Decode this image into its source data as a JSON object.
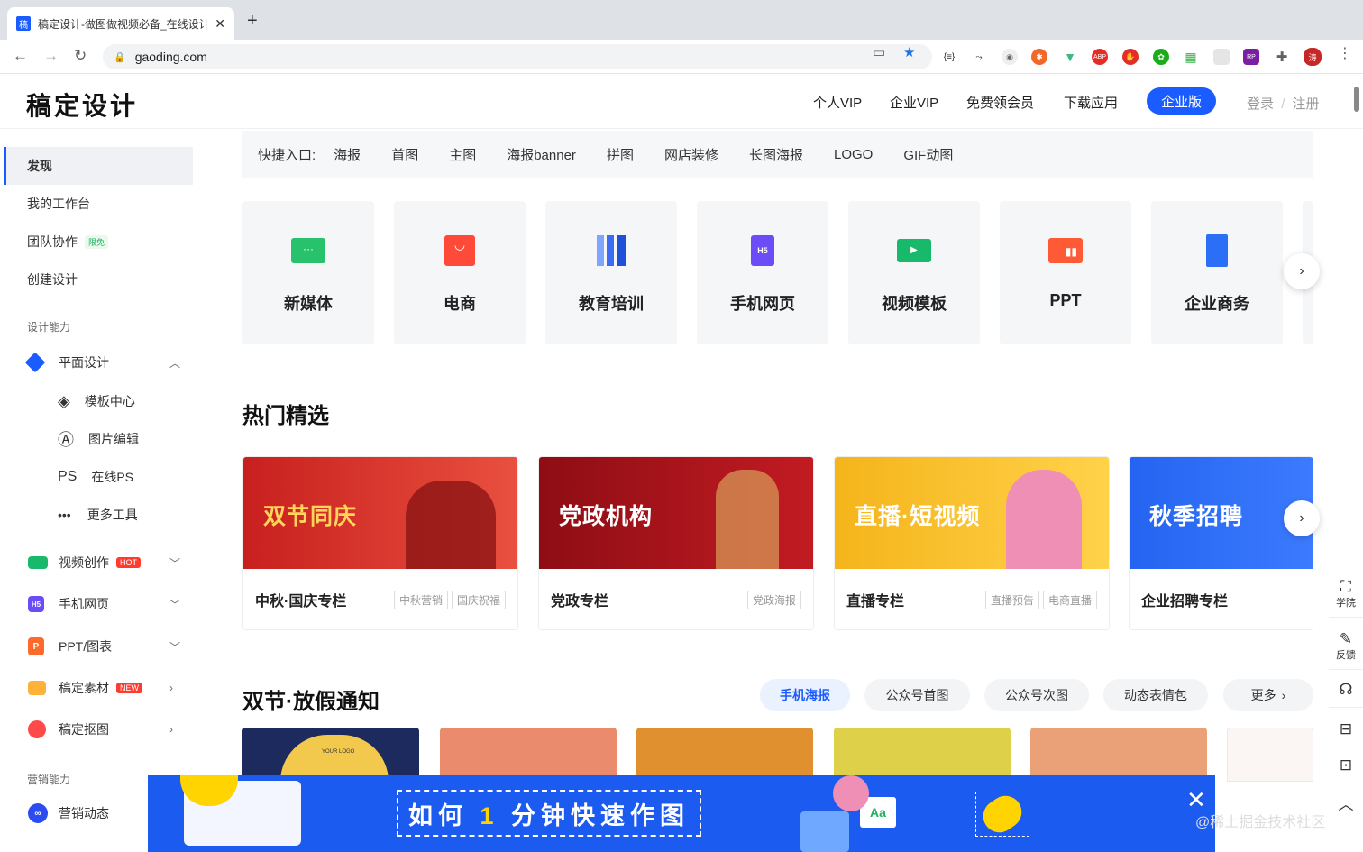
{
  "browser": {
    "tab_title": "稿定设计-做图做视频必备_在线设计",
    "tab_favicon": "稿",
    "url": "gaoding.com",
    "profile_initial": "涛"
  },
  "header": {
    "logo": "稿定设计",
    "nav": [
      "个人VIP",
      "企业VIP",
      "免费领会员",
      "下载应用"
    ],
    "enterprise_button": "企业版",
    "login": "登录",
    "divider": "/",
    "register": "注册"
  },
  "sidebar": {
    "items": [
      {
        "label": "发现"
      },
      {
        "label": "我的工作台"
      },
      {
        "label": "团队协作",
        "badge": "限免"
      },
      {
        "label": "创建设计"
      }
    ],
    "section_design": "设计能力",
    "design": [
      {
        "label": "平面设计",
        "chevron": "up"
      },
      {
        "label": "模板中心"
      },
      {
        "label": "图片编辑"
      },
      {
        "label": "在线PS",
        "icon_text": "PS"
      },
      {
        "label": "更多工具",
        "icon_text": "•••"
      },
      {
        "label": "视频创作",
        "badge": "HOT",
        "chevron": "down"
      },
      {
        "label": "手机网页",
        "icon_text": "H5",
        "chevron": "down"
      },
      {
        "label": "PPT/图表",
        "icon_text": "P",
        "chevron": "down"
      },
      {
        "label": "稿定素材",
        "badge": "NEW",
        "chevron": "right"
      },
      {
        "label": "稿定抠图",
        "chevron": "right"
      }
    ],
    "section_marketing": "营销能力",
    "marketing": [
      {
        "label": "营销动态"
      }
    ]
  },
  "quick": {
    "label": "快捷入口:",
    "items": [
      "海报",
      "首图",
      "主图",
      "海报banner",
      "拼图",
      "网店装修",
      "长图海报",
      "LOGO",
      "GIF动图"
    ]
  },
  "categories": [
    {
      "label": "新媒体",
      "color": "#27c26b"
    },
    {
      "label": "电商",
      "color": "#ff4a3a"
    },
    {
      "label": "教育培训",
      "color": "#3b6cf6"
    },
    {
      "label": "手机网页",
      "color": "#6b4cf6",
      "icon_text": "H5"
    },
    {
      "label": "视频模板",
      "color": "#18b96b"
    },
    {
      "label": "PPT",
      "color": "#ff5a36"
    },
    {
      "label": "企业商务",
      "color": "#2a6ff5"
    }
  ],
  "hot": {
    "title": "热门精选",
    "cards": [
      {
        "banner": "双节同庆",
        "name": "中秋·国庆专栏",
        "tags": [
          "中秋营销",
          "国庆祝福"
        ],
        "bg": "#c8201f"
      },
      {
        "banner": "党政机构",
        "name": "党政专栏",
        "tags": [
          "党政海报"
        ],
        "bg": "#a3101a"
      },
      {
        "banner": "直播·短视频",
        "name": "直播专栏",
        "tags": [
          "直播预告",
          "电商直播"
        ],
        "bg": "#f5b41b"
      },
      {
        "banner": "秋季招聘",
        "name": "企业招聘专栏",
        "tags": [],
        "bg": "#2464f0"
      }
    ]
  },
  "section2": {
    "title": "双节·放假通知",
    "pills": [
      "手机海报",
      "公众号首图",
      "公众号次图",
      "动态表情包",
      "更多"
    ],
    "thumbs": [
      "#1c2a5e",
      "#ea8b6e",
      "#e0902f",
      "#dfd04a",
      "#eaa178",
      "#fbf6f4"
    ],
    "thumb_text": "YOUR LOGO"
  },
  "rightbar": [
    {
      "icon": "academy-icon",
      "label": "学院",
      "glyph": "⛶"
    },
    {
      "icon": "feedback-icon",
      "label": "反馈",
      "glyph": "✎"
    },
    {
      "icon": "headset-icon",
      "label": "",
      "glyph": "☊"
    },
    {
      "icon": "briefcase-icon",
      "label": "",
      "glyph": "⊟"
    },
    {
      "icon": "chat-icon",
      "label": "",
      "glyph": "⊡"
    },
    {
      "icon": "back-to-top-icon",
      "label": "",
      "glyph": "︿"
    }
  ],
  "ad": {
    "title": "如何 1 分钟快速作图",
    "highlight": "1",
    "icon_label": "Aa"
  },
  "watermark": "@稀土掘金技术社区"
}
